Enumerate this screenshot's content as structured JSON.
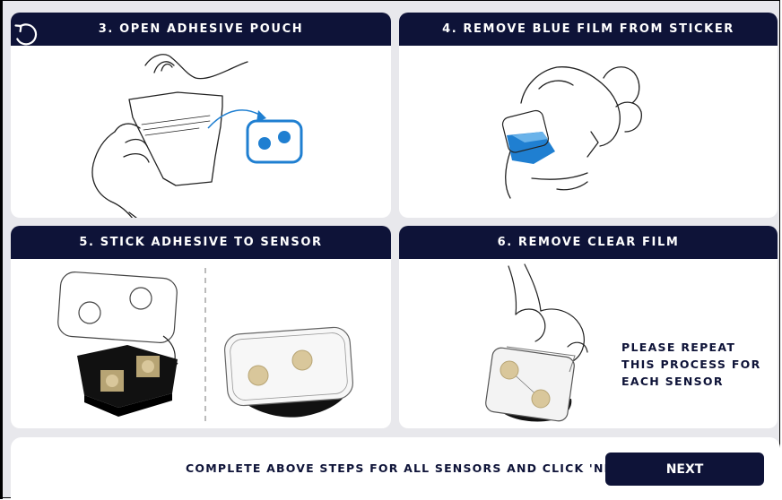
{
  "steps": [
    {
      "title": "3. OPEN ADHESIVE POUCH"
    },
    {
      "title": "4. REMOVE BLUE FILM FROM STICKER"
    },
    {
      "title": "5. STICK ADHESIVE TO SENSOR"
    },
    {
      "title": "6. REMOVE CLEAR FILM",
      "note": "PLEASE REPEAT THIS PROCESS FOR EACH SENSOR"
    }
  ],
  "footer": {
    "instruction": "COMPLETE ABOVE STEPS FOR ALL SENSORS AND CLICK 'NEXT'",
    "next_label": "NEXT"
  },
  "icons": {
    "restart": "restart-icon"
  },
  "colors": {
    "header_navy": "#0e1338",
    "accent_blue": "#1f7fd1",
    "panel_background": "#e8e8ec",
    "card_background": "#ffffff"
  }
}
